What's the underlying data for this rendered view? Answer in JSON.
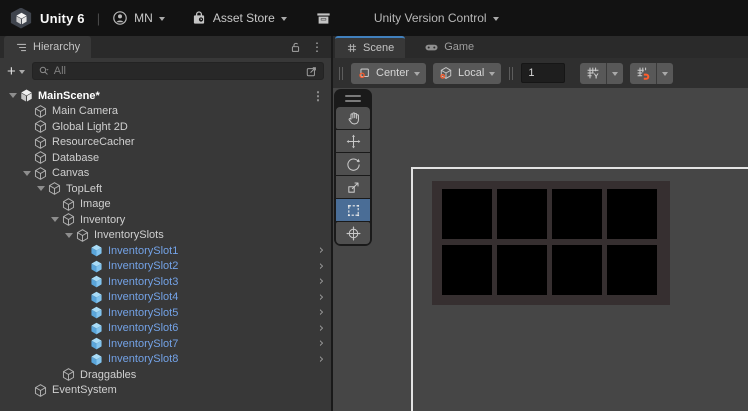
{
  "topbar": {
    "brand": "Unity 6",
    "divider": "|",
    "account_label": "MN",
    "asset_store_label": "Asset Store",
    "version_control_label": "Unity Version Control"
  },
  "hierarchy": {
    "tab_label": "Hierarchy",
    "search": {
      "placeholder": "All"
    },
    "rows": [
      {
        "label": "MainScene*",
        "depth": 0,
        "icon": "scene",
        "expanded": true,
        "bold": true,
        "right": "kebab"
      },
      {
        "label": "Main Camera",
        "depth": 1,
        "icon": "cube"
      },
      {
        "label": "Global Light 2D",
        "depth": 1,
        "icon": "cube"
      },
      {
        "label": "ResourceCacher",
        "depth": 1,
        "icon": "cube"
      },
      {
        "label": "Database",
        "depth": 1,
        "icon": "cube"
      },
      {
        "label": "Canvas",
        "depth": 1,
        "icon": "cube",
        "expanded": true
      },
      {
        "label": "TopLeft",
        "depth": 2,
        "icon": "cube",
        "expanded": true
      },
      {
        "label": "Image",
        "depth": 3,
        "icon": "cube"
      },
      {
        "label": "Inventory",
        "depth": 3,
        "icon": "cube",
        "expanded": true
      },
      {
        "label": "InventorySlots",
        "depth": 4,
        "icon": "cube",
        "expanded": true
      },
      {
        "label": "InventorySlot1",
        "depth": 5,
        "icon": "prefab",
        "right": "chevron"
      },
      {
        "label": "InventorySlot2",
        "depth": 5,
        "icon": "prefab",
        "right": "chevron"
      },
      {
        "label": "InventorySlot3",
        "depth": 5,
        "icon": "prefab",
        "right": "chevron"
      },
      {
        "label": "InventorySlot4",
        "depth": 5,
        "icon": "prefab",
        "right": "chevron"
      },
      {
        "label": "InventorySlot5",
        "depth": 5,
        "icon": "prefab",
        "right": "chevron"
      },
      {
        "label": "InventorySlot6",
        "depth": 5,
        "icon": "prefab",
        "right": "chevron"
      },
      {
        "label": "InventorySlot7",
        "depth": 5,
        "icon": "prefab",
        "right": "chevron"
      },
      {
        "label": "InventorySlot8",
        "depth": 5,
        "icon": "prefab",
        "right": "chevron"
      },
      {
        "label": "Draggables",
        "depth": 3,
        "icon": "cube"
      },
      {
        "label": "EventSystem",
        "depth": 1,
        "icon": "cube"
      }
    ]
  },
  "scene_panel": {
    "scene_tab_label": "Scene",
    "game_tab_label": "Game",
    "toolbar": {
      "pivot_label": "Center",
      "orientation_label": "Local",
      "grid_size_value": "1"
    },
    "tools": [
      {
        "name": "hand-tool"
      },
      {
        "name": "move-tool"
      },
      {
        "name": "rotate-tool"
      },
      {
        "name": "scale-tool"
      },
      {
        "name": "rect-tool",
        "selected": true
      },
      {
        "name": "transform-tool"
      }
    ],
    "canvas": {
      "slot_count": 8,
      "columns": 4,
      "rows": 2
    }
  },
  "colors": {
    "accent_blue_tab": "#4180bd",
    "selected_tool": "#4a6d96",
    "prefab_text": "#73a2e6",
    "snap_orange": "#ff5d2b",
    "canvas_outline": "#e3e3e3",
    "inventory_panel": "#362f30",
    "slot_black": "#000000"
  }
}
